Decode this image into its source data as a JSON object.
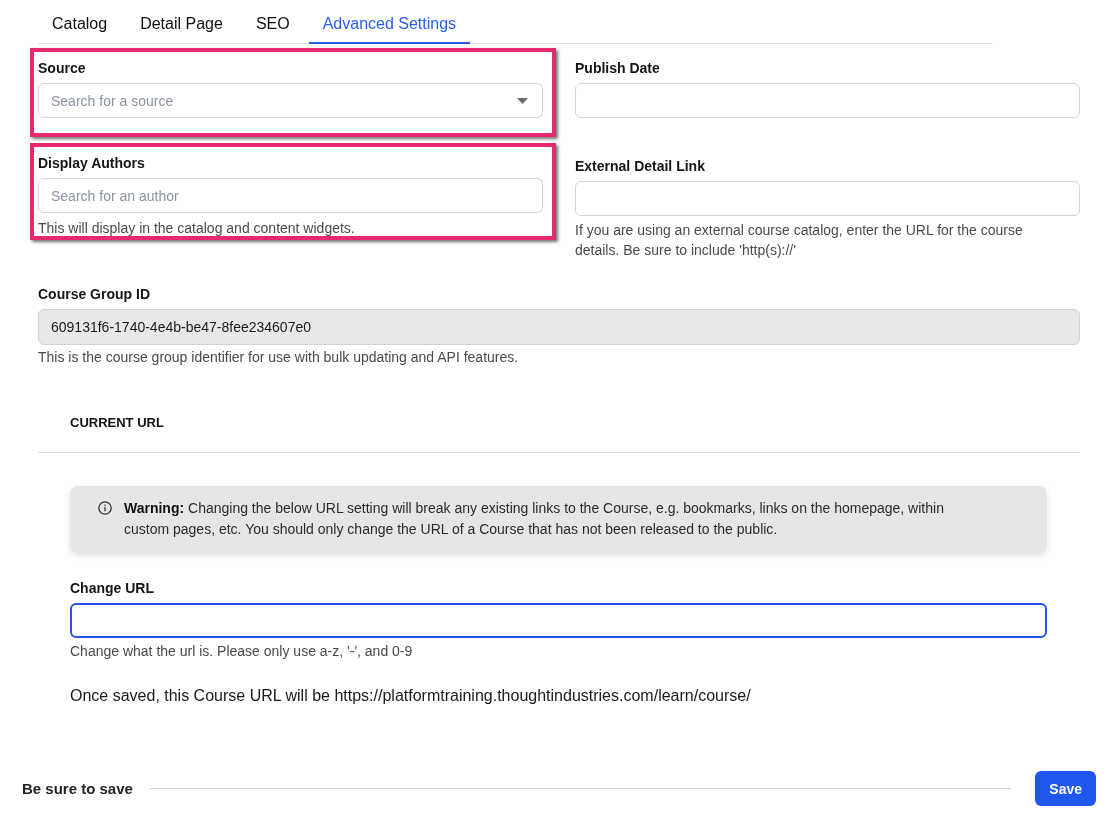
{
  "tabs": [
    {
      "label": "Catalog",
      "selected": false
    },
    {
      "label": "Detail Page",
      "selected": false
    },
    {
      "label": "SEO",
      "selected": false
    },
    {
      "label": "Advanced Settings",
      "selected": true
    }
  ],
  "left_fields": [
    {
      "kind": "select",
      "label": "Source",
      "placeholder": "Search for a source",
      "highlighted": true
    },
    {
      "kind": "input",
      "label": "Display Authors",
      "placeholder": "Search for an author",
      "help": "This will display in the catalog and content widgets.",
      "highlighted": true
    }
  ],
  "right_fields": [
    {
      "kind": "input",
      "label": "Publish Date"
    },
    {
      "kind": "input",
      "label": "External Detail Link",
      "help": "If you are using an external course catalog, enter the URL for the course details. Be sure to include 'http(s)://'"
    }
  ],
  "course_group": {
    "label": "Course Group ID",
    "value": "609131f6-1740-4e4b-be47-8fee234607e0",
    "disabled": true,
    "help": "This is the course group identifier for use with bulk updating and API features."
  },
  "current_url": {
    "heading": "CURRENT URL",
    "warning": "**Warning:** Changing the below URL setting will break any existing links to the Course, e.g. bookmarks, links on the homepage, within custom pages, etc. You should only change the URL of a Course that has not been released to the public.",
    "change_url": {
      "label": "Change URL",
      "focused": true,
      "help": "Change what the url is. Please only use a-z, '-', and 0-9"
    },
    "preview": "Once saved, this Course URL will be https://platformtraining.thoughtindustries.com/learn/course/"
  },
  "footer": {
    "text": "Be sure to save",
    "button": "Save"
  }
}
